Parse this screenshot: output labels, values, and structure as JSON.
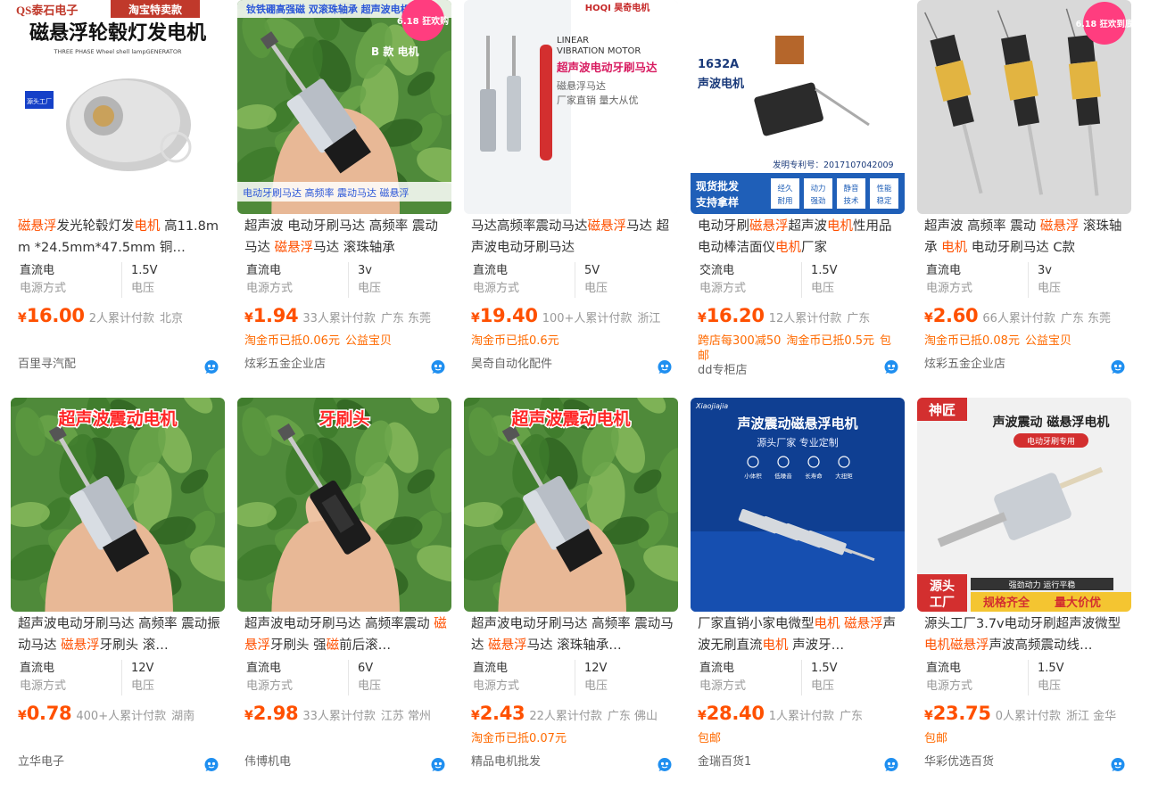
{
  "products": [
    {
      "id": "p1",
      "title_parts": [
        {
          "t": "磁悬浮",
          "hl": true
        },
        {
          "t": "发光轮毂灯发",
          "hl": false
        },
        {
          "t": "电机",
          "hl": true
        },
        {
          "t": " 高11.8mm *24.5mm*47.5mm 铜…",
          "hl": false
        }
      ],
      "attr1_value": "直流电",
      "attr1_label": "电源方式",
      "attr2_value": "1.5V",
      "attr2_label": "电压",
      "currency": "¥",
      "price": "16.00",
      "sold": "2人累计付款",
      "location": "北京",
      "promos": [],
      "shop": "百里寻汽配",
      "image_text": {
        "brand": "QS泰石电子",
        "badge": "淘宝特卖款",
        "headline": "磁悬浮轮毂灯发电机",
        "sub": "THREE PHASE Wheel shell lampGENERATOR",
        "tag": "源头工厂"
      }
    },
    {
      "id": "p2",
      "title_parts": [
        {
          "t": "超声波 电动牙刷马达 高频率 震动马达 ",
          "hl": false
        },
        {
          "t": "磁悬浮",
          "hl": true
        },
        {
          "t": "马达 滚珠轴承",
          "hl": false
        }
      ],
      "attr1_value": "直流电",
      "attr1_label": "电源方式",
      "attr2_value": "3v",
      "attr2_label": "电压",
      "currency": "¥",
      "price": "1.94",
      "sold": "33人累计付款",
      "location": "广东 东莞",
      "promos": [
        "淘金币已抵0.06元",
        "公益宝贝"
      ],
      "shop": "炫彩五金企业店",
      "image_text": {
        "top": "钕铁硼高强磁  双滚珠轴承  超声波电机",
        "model": "B 款 电机",
        "bottom": "电动牙刷马达 高频率 震动马达 磁悬浮",
        "sale": "6.18 狂欢购"
      }
    },
    {
      "id": "p3",
      "title_parts": [
        {
          "t": "马达高频率震动马达",
          "hl": false
        },
        {
          "t": "磁悬浮",
          "hl": true
        },
        {
          "t": "马达 超声波电动牙刷马达",
          "hl": false
        }
      ],
      "attr1_value": "直流电",
      "attr1_label": "电源方式",
      "attr2_value": "5V",
      "attr2_label": "电压",
      "currency": "¥",
      "price": "19.40",
      "sold": "100+人累计付款",
      "location": "浙江",
      "promos": [
        "淘金币已抵0.6元"
      ],
      "shop": "昊奇自动化配件",
      "image_text": {
        "logo": "HOQI 昊奇电机",
        "line1": "LINEAR",
        "line2": "VIBRATION MOTOR",
        "headline": "超声波电动牙刷马达",
        "sub1": "磁悬浮马达",
        "sub2": "厂家直销  量大从优"
      }
    },
    {
      "id": "p4",
      "title_parts": [
        {
          "t": "电动牙刷",
          "hl": false
        },
        {
          "t": "磁悬浮",
          "hl": true
        },
        {
          "t": "超声波",
          "hl": false
        },
        {
          "t": "电机",
          "hl": true
        },
        {
          "t": "性用品电动棒洁面仪",
          "hl": false
        },
        {
          "t": "电机",
          "hl": true
        },
        {
          "t": "厂家",
          "hl": false
        }
      ],
      "attr1_value": "交流电",
      "attr1_label": "电源方式",
      "attr2_value": "1.5V",
      "attr2_label": "电压",
      "currency": "¥",
      "price": "16.20",
      "sold": "12人累计付款",
      "location": "广东",
      "promos": [
        "跨店每300减50",
        "淘金币已抵0.5元",
        "包邮"
      ],
      "shop": "dd专柜店",
      "image_text": {
        "model": "1632A",
        "name": "声波电机",
        "patent": "发明专利号：2017107042009",
        "cta1": "现货批发",
        "cta2": "支持拿样",
        "f1": "经久耐用",
        "f2": "动力强劲",
        "f3": "静音技术",
        "f4": "性能稳定"
      }
    },
    {
      "id": "p5",
      "title_parts": [
        {
          "t": "超声波 高频率 震动 ",
          "hl": false
        },
        {
          "t": "磁悬浮",
          "hl": true
        },
        {
          "t": " 滚珠轴承 ",
          "hl": false
        },
        {
          "t": "电机",
          "hl": true
        },
        {
          "t": " 电动牙刷马达 C款",
          "hl": false
        }
      ],
      "attr1_value": "直流电",
      "attr1_label": "电源方式",
      "attr2_value": "3v",
      "attr2_label": "电压",
      "currency": "¥",
      "price": "2.60",
      "sold": "66人累计付款",
      "location": "广东 东莞",
      "promos": [
        "淘金币已抵0.08元",
        "公益宝贝"
      ],
      "shop": "炫彩五金企业店",
      "image_text": {
        "sale": "6.18 狂欢到底"
      }
    },
    {
      "id": "p6",
      "title_parts": [
        {
          "t": "超声波电动牙刷马达 高频率 震动振动马达 ",
          "hl": false
        },
        {
          "t": "磁悬浮",
          "hl": true
        },
        {
          "t": "牙刷头 滚…",
          "hl": false
        }
      ],
      "attr1_value": "直流电",
      "attr1_label": "电源方式",
      "attr2_value": "12V",
      "attr2_label": "电压",
      "currency": "¥",
      "price": "0.78",
      "sold": "400+人累计付款",
      "location": "湖南",
      "promos": [],
      "shop": "立华电子",
      "image_text": {
        "headline": "超声波震动电机"
      }
    },
    {
      "id": "p7",
      "title_parts": [
        {
          "t": "超声波电动牙刷马达 高频率震动 ",
          "hl": false
        },
        {
          "t": "磁悬浮",
          "hl": true
        },
        {
          "t": "牙刷头 强",
          "hl": false
        },
        {
          "t": "磁",
          "hl": true
        },
        {
          "t": "前后滚…",
          "hl": false
        }
      ],
      "attr1_value": "直流电",
      "attr1_label": "电源方式",
      "attr2_value": "6V",
      "attr2_label": "电压",
      "currency": "¥",
      "price": "2.98",
      "sold": "33人累计付款",
      "location": "江苏 常州",
      "promos": [],
      "shop": "伟博机电",
      "image_text": {
        "headline": "牙刷头"
      }
    },
    {
      "id": "p8",
      "title_parts": [
        {
          "t": "超声波电动牙刷马达 高频率 震动马达 ",
          "hl": false
        },
        {
          "t": "磁悬浮",
          "hl": true
        },
        {
          "t": "马达 滚珠轴承…",
          "hl": false
        }
      ],
      "attr1_value": "直流电",
      "attr1_label": "电源方式",
      "attr2_value": "12V",
      "attr2_label": "电压",
      "currency": "¥",
      "price": "2.43",
      "sold": "22人累计付款",
      "location": "广东 佛山",
      "promos": [
        "淘金币已抵0.07元"
      ],
      "shop": "精品电机批发",
      "image_text": {
        "headline": "超声波震动电机"
      }
    },
    {
      "id": "p9",
      "title_parts": [
        {
          "t": "厂家直销小家电微型",
          "hl": false
        },
        {
          "t": "电机",
          "hl": true
        },
        {
          "t": " ",
          "hl": false
        },
        {
          "t": "磁悬浮",
          "hl": true
        },
        {
          "t": "声波无刷直流",
          "hl": false
        },
        {
          "t": "电机",
          "hl": true
        },
        {
          "t": " 声波牙…",
          "hl": false
        }
      ],
      "attr1_value": "直流电",
      "attr1_label": "电源方式",
      "attr2_value": "1.5V",
      "attr2_label": "电压",
      "currency": "¥",
      "price": "28.40",
      "sold": "1人累计付款",
      "location": "广东",
      "promos": [
        "包邮"
      ],
      "shop": "金瑞百货1",
      "image_text": {
        "logo": "Xiaojiajia",
        "headline": "声波震动磁悬浮电机",
        "sub": "源头厂家  专业定制",
        "i1": "小体积",
        "i2": "低噪音",
        "i3": "长寿命",
        "i4": "大扭矩"
      }
    },
    {
      "id": "p10",
      "title_parts": [
        {
          "t": "源头工厂3.7v电动牙刷超声波微型",
          "hl": false
        },
        {
          "t": "电机",
          "hl": true
        },
        {
          "t": "磁悬浮",
          "hl": true
        },
        {
          "t": "声波高频震动线…",
          "hl": false
        }
      ],
      "attr1_value": "直流电",
      "attr1_label": "电源方式",
      "attr2_value": "1.5V",
      "attr2_label": "电压",
      "currency": "¥",
      "price": "23.75",
      "sold": "0人累计付款",
      "location": "浙江 金华",
      "promos": [
        "包邮"
      ],
      "shop": "华彩优选百货",
      "image_text": {
        "badge": "神匠",
        "headline": "声波震动 磁悬浮电机",
        "pill": "电动牙刷专用",
        "corner1": "源头",
        "corner2": "工厂",
        "bar": "强劲动力 运行平稳",
        "spec1": "规格齐全",
        "spec2": "量大价优"
      }
    }
  ],
  "colors": {
    "accent": "#ff5000",
    "promo": "#ff6a00",
    "muted": "#999999",
    "title": "#333333"
  },
  "icons": {
    "wangwang": "wangwang-icon"
  }
}
